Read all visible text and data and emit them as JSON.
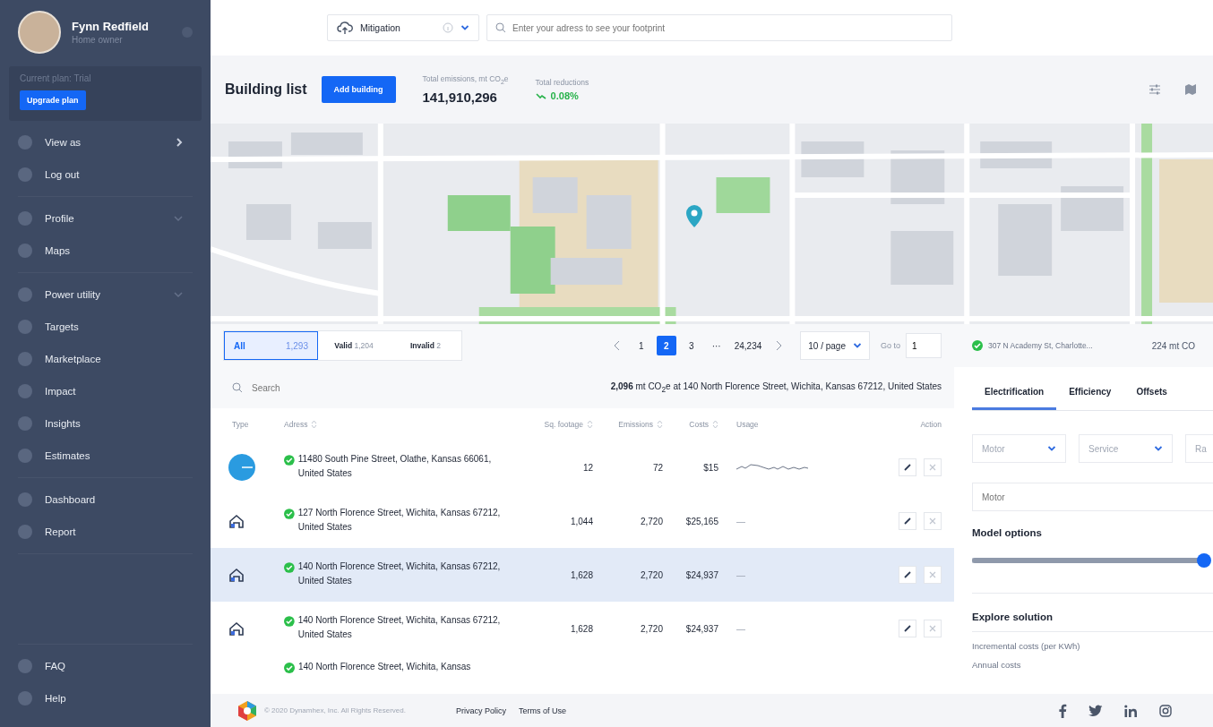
{
  "user": {
    "name": "Fynn Redfield",
    "role": "Home owner"
  },
  "plan": {
    "label": "Current plan: Trial",
    "button": "Upgrade plan"
  },
  "sidebar": {
    "groups": [
      [
        {
          "label": "View as",
          "kind": "submenu"
        },
        {
          "label": "Log out",
          "kind": "link"
        }
      ],
      [
        {
          "label": "Profile",
          "kind": "expandable"
        },
        {
          "label": "Maps",
          "kind": "link"
        }
      ],
      [
        {
          "label": "Power utility",
          "kind": "expandable"
        },
        {
          "label": "Targets",
          "kind": "link"
        },
        {
          "label": "Marketplace",
          "kind": "link"
        },
        {
          "label": "Impact",
          "kind": "link"
        },
        {
          "label": "Insights",
          "kind": "link"
        },
        {
          "label": "Estimates",
          "kind": "link"
        }
      ],
      [
        {
          "label": "Dashboard",
          "kind": "link"
        },
        {
          "label": "Report",
          "kind": "link"
        }
      ]
    ],
    "bottom": [
      {
        "label": "FAQ"
      },
      {
        "label": "Help"
      }
    ]
  },
  "topbar": {
    "mode": "Mitigation",
    "search": {
      "placeholder": "Enter your adress to see your footprint"
    }
  },
  "header": {
    "title": "Building list",
    "button": "Add building",
    "stats": [
      {
        "label": "Total emissions, mt CO$_{2}$e",
        "value": "141,910,296",
        "kind": "plain"
      },
      {
        "label": "Total reductions",
        "value": "0.08%",
        "kind": "trend"
      }
    ]
  },
  "filters": [
    {
      "label": "All",
      "count": "1,293",
      "selected": true
    },
    {
      "label": "Valid",
      "count": "1,204",
      "selected": false
    },
    {
      "label": "Invalid",
      "count": "2",
      "selected": false
    }
  ],
  "pagination": {
    "pages": [
      {
        "label": "1",
        "selected": false
      },
      {
        "label": "2",
        "selected": true
      },
      {
        "label": "3",
        "selected": false
      },
      {
        "label": "···",
        "selected": false
      },
      {
        "label": "24,234",
        "selected": false
      }
    ],
    "page_size": "10 / page",
    "goto_label": "Go to",
    "goto_value": "1"
  },
  "search": {
    "placeholder": "Search"
  },
  "summary": "**2,096** mt CO$_{2}$e at 140 North Florence Street, Wichita, Kansas 67212, United States",
  "table": {
    "columns": [
      "Type",
      "Adress",
      "Sq. footage",
      "Emissions",
      "Costs",
      "Usage",
      "Action"
    ],
    "rows": [
      {
        "kind": "circle",
        "address": "11480 South Pine Street, Olathe, Kansas 66061, United States",
        "sq": "12",
        "emissions": "72",
        "costs": "$15",
        "has_sparkline": true,
        "selected": false
      },
      {
        "kind": "house",
        "address": "127 North Florence Street, Wichita, Kansas 67212, United States",
        "sq": "1,044",
        "emissions": "2,720",
        "costs": "$25,165",
        "usage": "—",
        "selected": false
      },
      {
        "kind": "house",
        "address": "140 North Florence Street, Wichita, Kansas 67212, United States",
        "sq": "1,628",
        "emissions": "2,720",
        "costs": "$24,937",
        "usage": "—",
        "selected": true
      },
      {
        "kind": "house",
        "address": "140 North Florence Street, Wichita, Kansas 67212, United States",
        "sq": "1,628",
        "emissions": "2,720",
        "costs": "$24,937",
        "usage": "—",
        "selected": false
      }
    ],
    "partial_row": "140 North Florence Street, Wichita, Kansas"
  },
  "panel": {
    "address": "307 N Academy St, Charlotte...",
    "emissions": "224 mt CO",
    "tabs": [
      {
        "label": "Electrification",
        "selected": true
      },
      {
        "label": "Efficiency",
        "selected": false
      },
      {
        "label": "Offsets",
        "selected": false
      }
    ],
    "selects": [
      {
        "placeholder": "Motor",
        "kind": "dropdown"
      },
      {
        "placeholder": "Service",
        "kind": "dropdown"
      },
      {
        "placeholder": "Ra",
        "kind": "dropdown"
      }
    ],
    "field": {
      "placeholder": "Motor"
    },
    "model_title": "Model options",
    "slider": {
      "level": 0.98
    },
    "explore_title": "Explore solution",
    "explore_items": [
      "Incremental costs (per KWh)",
      "Annual costs"
    ]
  },
  "footer": {
    "copyright": "© 2020 Dynamhex, Inc. All Rights Reserved.",
    "links": [
      "Privacy Policy",
      "Terms of Use"
    ]
  }
}
